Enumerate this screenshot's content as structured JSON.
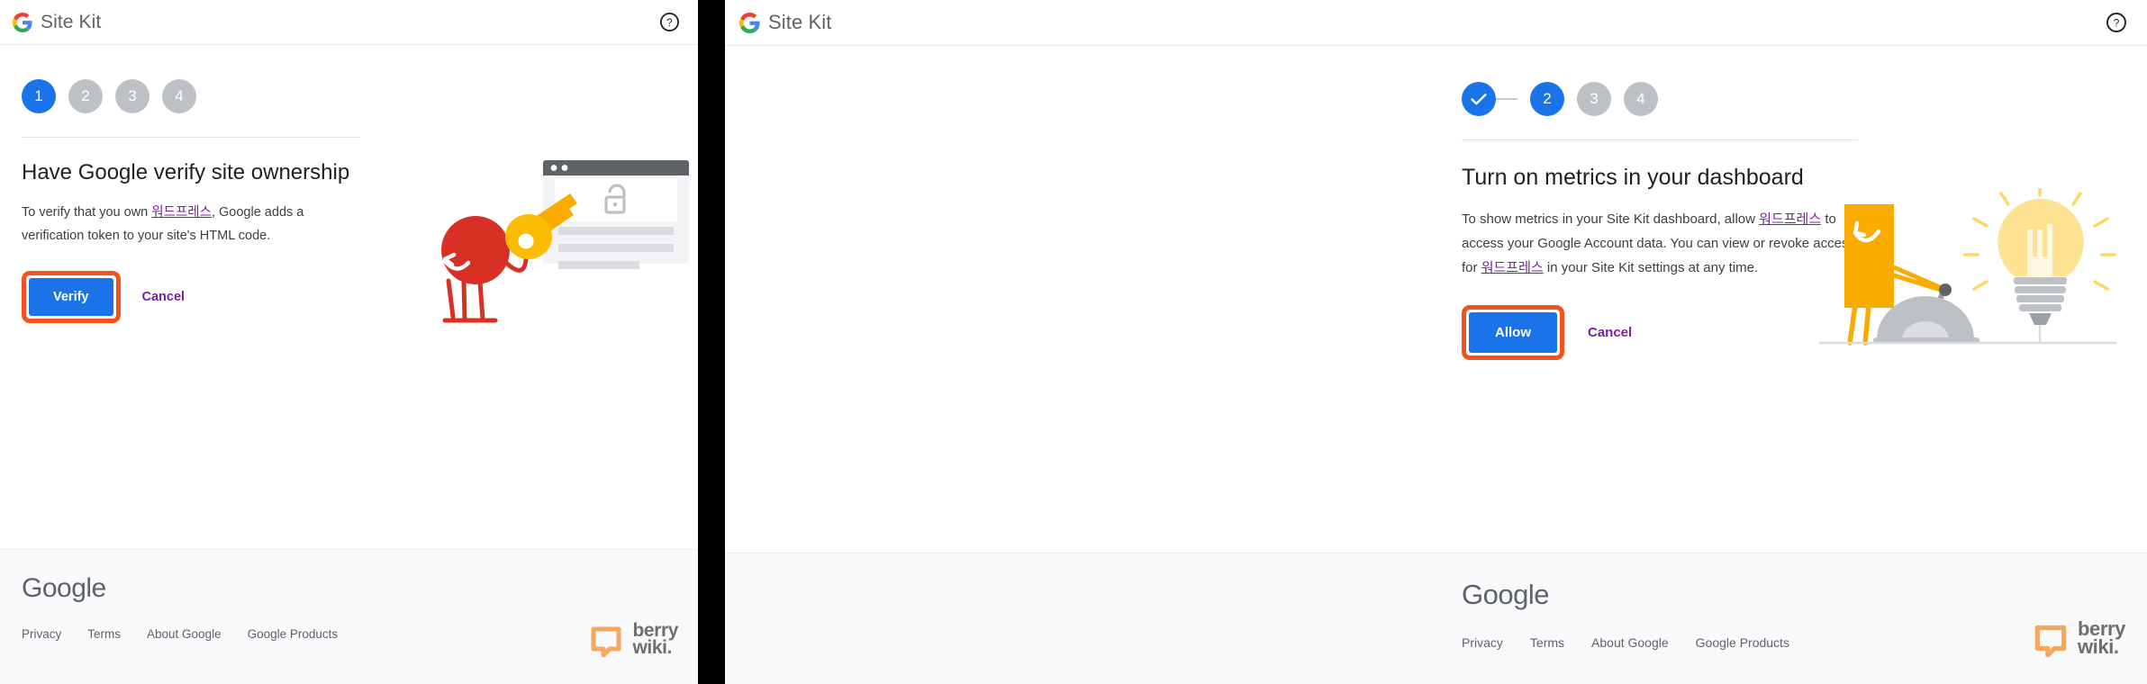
{
  "left_panel": {
    "header": {
      "brand": "Site Kit",
      "logo_icon": "google-g-icon",
      "help_icon": "help-circle-icon"
    },
    "stepper": {
      "steps": [
        {
          "label": "1",
          "state": "active"
        },
        {
          "label": "2",
          "state": "todo"
        },
        {
          "label": "3",
          "state": "todo"
        },
        {
          "label": "4",
          "state": "todo"
        }
      ]
    },
    "title": "Have Google verify site ownership",
    "body": {
      "part1": "To verify that you own ",
      "link1": "워드프레스",
      "part2": ", Google adds a verification token to your site's HTML code."
    },
    "primary_button": "Verify",
    "cancel_button": "Cancel",
    "illustration": "red-character-with-key-and-browser-lock",
    "footer": {
      "wordmark": "Google",
      "links": [
        "Privacy",
        "Terms",
        "About Google",
        "Google Products"
      ]
    },
    "watermark": {
      "line1": "berry",
      "line2": "wiki.",
      "icon": "speech-bubble-icon"
    }
  },
  "right_panel": {
    "header": {
      "brand": "Site Kit",
      "logo_icon": "google-g-icon",
      "help_icon": "help-circle-icon"
    },
    "stepper": {
      "steps": [
        {
          "label": "✓",
          "state": "done"
        },
        {
          "label": "2",
          "state": "active"
        },
        {
          "label": "3",
          "state": "todo"
        },
        {
          "label": "4",
          "state": "todo"
        }
      ]
    },
    "title": "Turn on metrics in your dashboard",
    "body": {
      "part1": "To show metrics in your Site Kit dashboard, allow ",
      "link1": "워드프레스",
      "part2": " to access your Google Account data. You can view or revoke access for ",
      "link2": "워드프레스",
      "part3": " in your Site Kit settings at any time."
    },
    "primary_button": "Allow",
    "cancel_button": "Cancel",
    "illustration": "orange-character-with-lightbulb",
    "footer": {
      "wordmark": "Google",
      "links": [
        "Privacy",
        "Terms",
        "About Google",
        "Google Products"
      ]
    },
    "watermark": {
      "line1": "berry",
      "line2": "wiki.",
      "icon": "speech-bubble-icon"
    }
  },
  "colors": {
    "primary_blue": "#1a73e8",
    "step_inactive_gray": "#bdc1c6",
    "link_purple": "#7b1fa2",
    "highlight_orange": "#f4511e",
    "footer_bg": "#f8f9fa",
    "text_primary": "#202124",
    "text_secondary": "#5f6368"
  }
}
